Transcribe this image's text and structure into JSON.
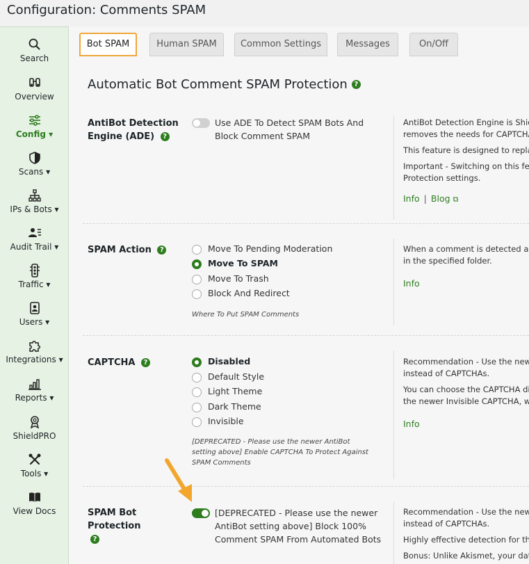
{
  "page": {
    "title": "Configuration: Comments SPAM"
  },
  "sidebar": {
    "items": [
      {
        "label": "Search",
        "icon": "search-icon"
      },
      {
        "label": "Overview",
        "icon": "binoculars-icon"
      },
      {
        "label": "Config ▾",
        "icon": "sliders-icon",
        "active": true
      },
      {
        "label": "Scans ▾",
        "icon": "shield-icon"
      },
      {
        "label": "IPs & Bots ▾",
        "icon": "network-icon"
      },
      {
        "label": "Audit Trail ▾",
        "icon": "person-lines-icon"
      },
      {
        "label": "Traffic ▾",
        "icon": "traffic-light-icon"
      },
      {
        "label": "Users ▾",
        "icon": "user-badge-icon"
      },
      {
        "label": "Integrations ▾",
        "icon": "puzzle-icon"
      },
      {
        "label": "Reports ▾",
        "icon": "bar-chart-icon"
      },
      {
        "label": "ShieldPRO",
        "icon": "award-icon"
      },
      {
        "label": "Tools ▾",
        "icon": "tools-icon"
      },
      {
        "label": "View Docs",
        "icon": "book-icon"
      }
    ]
  },
  "tabs": [
    {
      "label": "Bot SPAM",
      "active": true
    },
    {
      "label": "Human SPAM"
    },
    {
      "label": "Common Settings"
    },
    {
      "label": "Messages"
    },
    {
      "label": "On/Off"
    }
  ],
  "section": {
    "title": "Automatic Bot Comment SPAM Protection",
    "help": "?"
  },
  "options": {
    "ade": {
      "label": "AntiBot Detection Engine (ADE)",
      "help": "?",
      "toggle_text": "Use ADE To Detect SPAM Bots And Block Comment SPAM",
      "toggle_on": false,
      "desc": [
        "AntiBot Detection Engine is ShieldPRO",
        "removes the needs for CAPTCHA and",
        "This feature is designed to replace",
        "Important - Switching on this feature",
        "Protection settings."
      ],
      "links": {
        "info": "Info",
        "sep": "|",
        "blog": "Blog"
      }
    },
    "spam_action": {
      "label": "SPAM Action",
      "help": "?",
      "choices": [
        "Move To Pending Moderation",
        "Move To SPAM",
        "Move To Trash",
        "Block And Redirect"
      ],
      "selected": "Move To SPAM",
      "hint": "Where To Put SPAM Comments",
      "desc": [
        "When a comment is detected as being",
        "in the specified folder."
      ],
      "links": {
        "info": "Info"
      }
    },
    "captcha": {
      "label": "CAPTCHA",
      "help": "?",
      "choices": [
        "Disabled",
        "Default Style",
        "Light Theme",
        "Dark Theme",
        "Invisible"
      ],
      "selected": "Disabled",
      "hint": "[DEPRECATED - Please use the newer AntiBot setting above] Enable CAPTCHA To Protect Against SPAM Comments",
      "desc": [
        "Recommendation - Use the newer",
        "instead of CAPTCHAs.",
        "You can choose the CAPTCHA display",
        "the newer Invisible CAPTCHA, when"
      ],
      "links": {
        "info": "Info"
      }
    },
    "spam_bot": {
      "label": "SPAM Bot Protection",
      "help": "?",
      "toggle_text": "[DEPRECATED - Please use the newer AntiBot setting above] Block 100% Comment SPAM From Automated Bots",
      "toggle_on": true,
      "desc": [
        "Recommendation - Use the newer",
        "instead of CAPTCHAs.",
        "Highly effective detection for the most",
        "Bonus: Unlike Akismet, your data is"
      ]
    }
  },
  "colors": {
    "accent": "#2d7d1f",
    "tab_highlight": "#f0a63a",
    "arrow": "#f2a62c",
    "sidebar_bg": "#e6f2e3"
  }
}
